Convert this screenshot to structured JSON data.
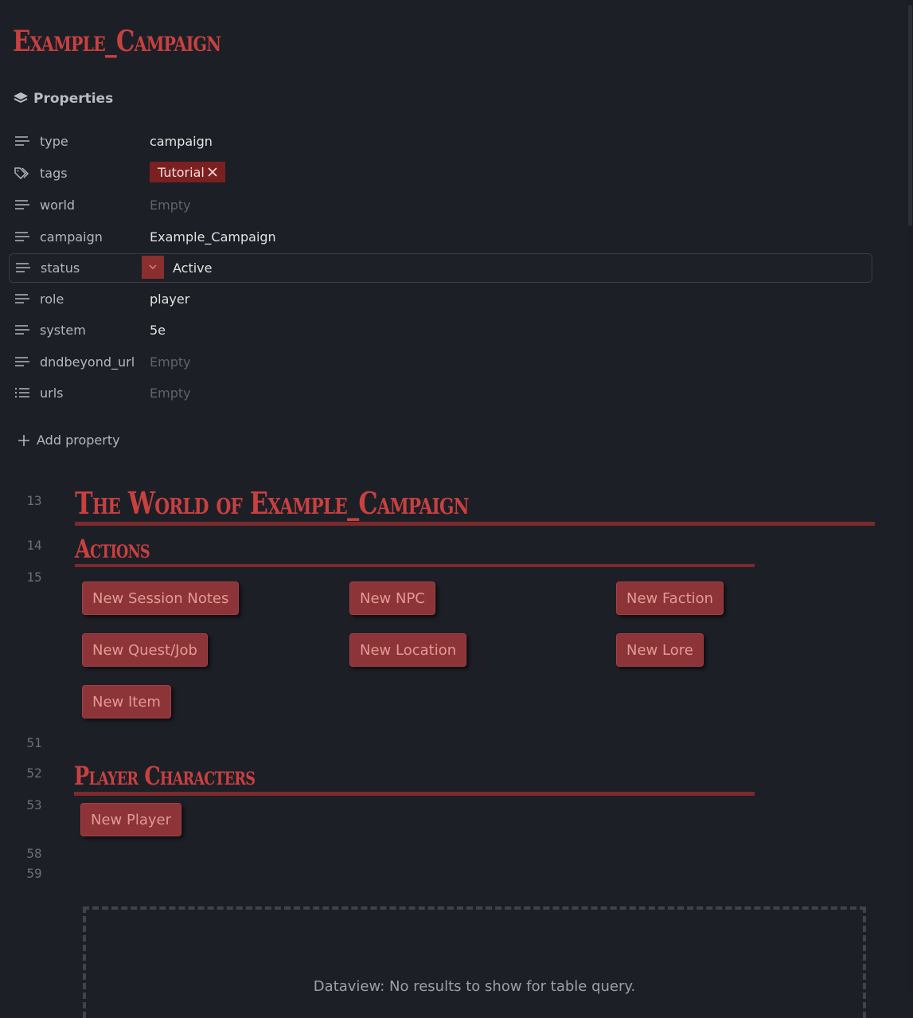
{
  "note": {
    "title": "Example_Campaign"
  },
  "properties": {
    "header": "Properties",
    "items": [
      {
        "key": "type",
        "value": "campaign",
        "icon": "text-lines-icon"
      },
      {
        "key": "tags",
        "value": "Tutorial",
        "icon": "tags-icon"
      },
      {
        "key": "world",
        "value": "Empty",
        "icon": "text-lines-icon"
      },
      {
        "key": "campaign",
        "value": "Example_Campaign",
        "icon": "text-lines-icon"
      },
      {
        "key": "status",
        "value": "Active",
        "icon": "text-lines-icon"
      },
      {
        "key": "role",
        "value": "player",
        "icon": "text-lines-icon"
      },
      {
        "key": "system",
        "value": "5e",
        "icon": "text-lines-icon"
      },
      {
        "key": "dndbeyond_url",
        "value": "Empty",
        "icon": "text-lines-icon"
      },
      {
        "key": "urls",
        "value": "Empty",
        "icon": "list-icon"
      }
    ],
    "add_label": "Add property"
  },
  "content": {
    "line_numbers": [
      "13",
      "14",
      "15",
      "51",
      "52",
      "53",
      "58",
      "59"
    ],
    "world_heading": "The World of Example_Campaign",
    "actions_heading": "Actions",
    "action_buttons": [
      "New Session Notes",
      "New NPC",
      "New Faction",
      "New Quest/Job",
      "New Location",
      "New Lore",
      "New Item"
    ],
    "players_heading": "Player Characters",
    "new_player_label": "New Player",
    "dataview_message": "Dataview: No results to show for table query."
  },
  "colors": {
    "background": "#1d1f26",
    "accent": "#c84040",
    "button": "#8c3437",
    "tag": "#7a2020"
  }
}
